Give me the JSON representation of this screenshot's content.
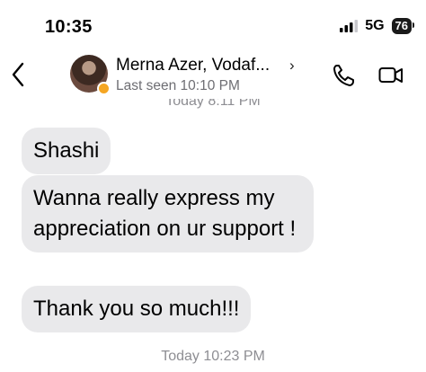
{
  "status_bar": {
    "time": "10:35",
    "network": "5G",
    "battery": "76"
  },
  "header": {
    "contact_name": "Merna Azer, Vodaf...",
    "chevron": "›",
    "last_seen": "Last seen 10:10 PM",
    "icons": {
      "back": "chevron-left-icon",
      "call": "phone-icon",
      "video": "video-camera-icon"
    }
  },
  "conversation": {
    "timestamp_top": "Today 8:11 PM",
    "messages": [
      {
        "text": "Shashi"
      },
      {
        "text": "Wanna really express my appreciation on ur support !"
      },
      {
        "text": "Thank you so much!!!"
      }
    ],
    "timestamp_bottom": "Today 10:23 PM"
  },
  "colors": {
    "bubble_incoming": "#e9e9eb",
    "timestamp": "#8e8e93",
    "badge": "#f5a623"
  }
}
